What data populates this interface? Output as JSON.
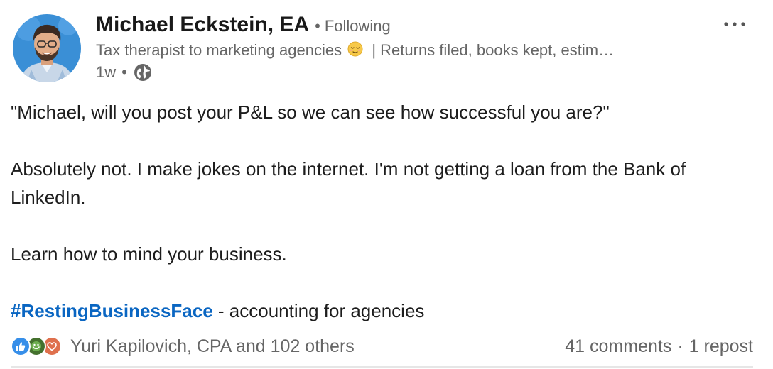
{
  "author": {
    "name": "Michael Eckstein, EA",
    "follow_status": "Following",
    "headline_before_emoji": "Tax therapist to marketing agencies",
    "headline_after_emoji": "| Returns filed, books kept, estim…",
    "headline_emoji": "relieved-face-emoji",
    "time_ago": "1w",
    "visibility_icon": "globe-icon"
  },
  "menu": {
    "icon": "more-options-icon"
  },
  "post": {
    "paragraphs": [
      "\"Michael, will you post your P&L so we can see how successful you are?\"",
      "Absolutely not. I make jokes on the internet. I'm not getting a loan from the Bank of LinkedIn.",
      "Learn how to mind your business."
    ],
    "hashtag": "#RestingBusinessFace",
    "hashtag_suffix": " - accounting for agencies"
  },
  "social": {
    "reactions": [
      {
        "type": "like",
        "icon": "like-icon",
        "color": "#378fe9"
      },
      {
        "type": "celebrate",
        "icon": "celebrate-icon",
        "color": "#44712e"
      },
      {
        "type": "love",
        "icon": "heart-icon",
        "color": "#df704d"
      }
    ],
    "reactors_text": "Yuri Kapilovich, CPA and 102 others",
    "comments": "41 comments",
    "separator": "·",
    "reposts": "1 repost"
  },
  "colors": {
    "accent_link": "#0a66c2",
    "muted_text": "#666666",
    "body_text": "#1d1d1d",
    "avatar_bg": "#3a8fd6"
  }
}
